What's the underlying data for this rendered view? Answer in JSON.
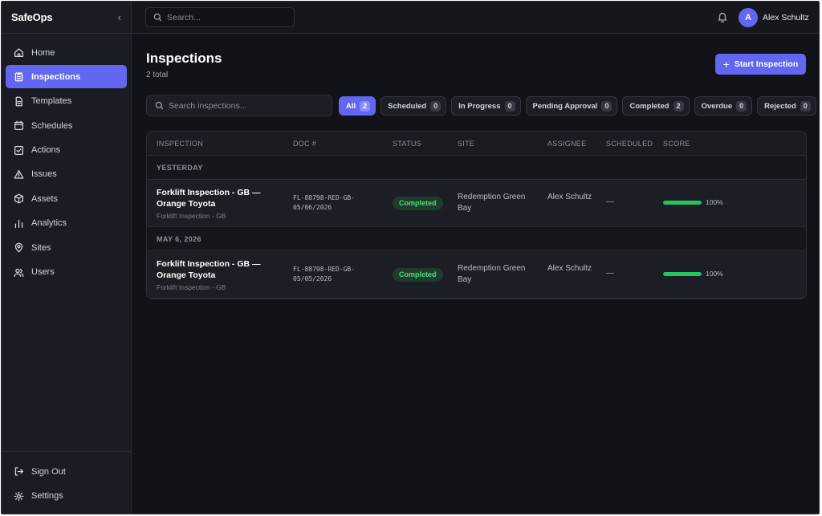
{
  "app": {
    "name": "SafeOps",
    "collapse_icon": "chevron-left-icon"
  },
  "sidebar": {
    "items": [
      {
        "label": "Home",
        "icon": "home-icon",
        "active": false
      },
      {
        "label": "Inspections",
        "icon": "clipboard-icon",
        "active": true
      },
      {
        "label": "Templates",
        "icon": "document-icon",
        "active": false
      },
      {
        "label": "Schedules",
        "icon": "calendar-icon",
        "active": false
      },
      {
        "label": "Actions",
        "icon": "checkbox-icon",
        "active": false
      },
      {
        "label": "Issues",
        "icon": "warning-icon",
        "active": false
      },
      {
        "label": "Assets",
        "icon": "box-icon",
        "active": false
      },
      {
        "label": "Analytics",
        "icon": "bar-chart-icon",
        "active": false
      },
      {
        "label": "Sites",
        "icon": "map-pin-icon",
        "active": false
      },
      {
        "label": "Users",
        "icon": "users-icon",
        "active": false
      }
    ],
    "bottom": [
      {
        "label": "Sign Out",
        "icon": "sign-out-icon"
      },
      {
        "label": "Settings",
        "icon": "gear-icon"
      }
    ]
  },
  "topbar": {
    "search_placeholder": "Search...",
    "user_initial": "A",
    "user_name": "Alex Schultz"
  },
  "page": {
    "title": "Inspections",
    "subtitle": "2 total",
    "start_button": "Start Inspection",
    "search_placeholder": "Search inspections..."
  },
  "filters": [
    {
      "label": "All",
      "count": "2",
      "active": true
    },
    {
      "label": "Scheduled",
      "count": "0",
      "active": false
    },
    {
      "label": "In Progress",
      "count": "0",
      "active": false
    },
    {
      "label": "Pending Approval",
      "count": "0",
      "active": false
    },
    {
      "label": "Completed",
      "count": "2",
      "active": false
    },
    {
      "label": "Overdue",
      "count": "0",
      "active": false
    },
    {
      "label": "Rejected",
      "count": "0",
      "active": false
    }
  ],
  "table": {
    "headers": [
      "INSPECTION",
      "DOC #",
      "STATUS",
      "SITE",
      "ASSIGNEE",
      "SCHEDULED",
      "SCORE"
    ],
    "groups": [
      {
        "label": "YESTERDAY",
        "rows": [
          {
            "title": "Forklift Inspection - GB — Orange Toyota",
            "subtitle": "Forklift Inspection - GB",
            "doc": "FL-88798-RED-GB-05/06/2026",
            "status": "Completed",
            "site": "Redemption Green Bay",
            "assignee": "Alex Schultz",
            "scheduled": "—",
            "score": "100%",
            "score_value": 100
          }
        ]
      },
      {
        "label": "MAY 6, 2026",
        "rows": [
          {
            "title": "Forklift Inspection - GB — Orange Toyota",
            "subtitle": "Forklift Inspection - GB",
            "doc": "FL-88798-RED-GB-05/05/2026",
            "status": "Completed",
            "site": "Redemption Green Bay",
            "assignee": "Alex Schultz",
            "scheduled": "—",
            "score": "100%",
            "score_value": 100
          }
        ]
      }
    ]
  },
  "colors": {
    "accent": "#6366f1",
    "success": "#22c55e",
    "background": "#121318"
  }
}
